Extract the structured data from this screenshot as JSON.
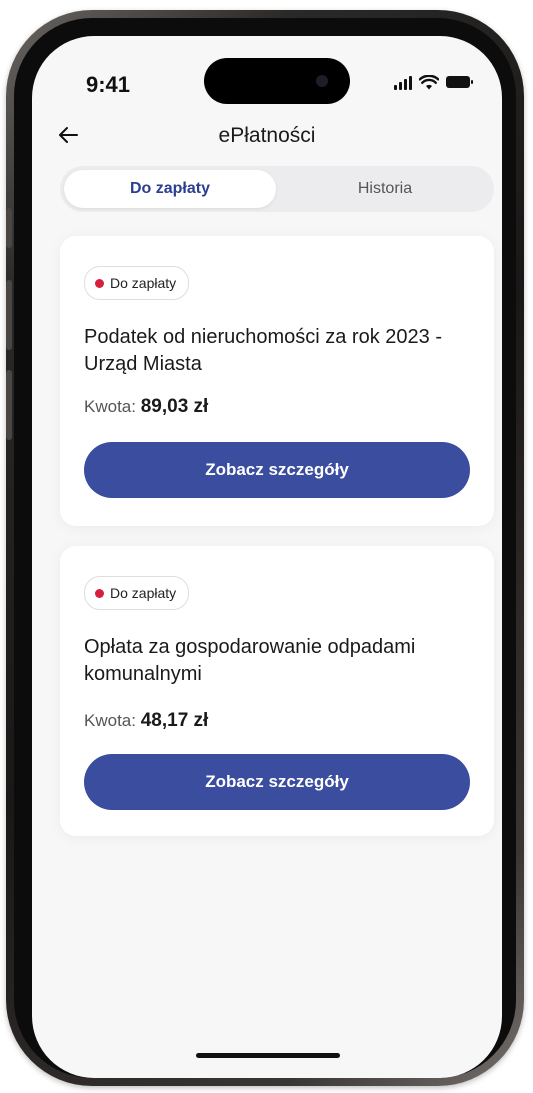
{
  "status_bar": {
    "time": "9:41"
  },
  "header": {
    "title": "ePłatności"
  },
  "tabs": [
    {
      "label": "Do zapłaty",
      "active": true
    },
    {
      "label": "Historia",
      "active": false
    }
  ],
  "payments": [
    {
      "status": "Do zapłaty",
      "title": "Podatek od nieruchomości za rok 2023 - Urząd Miasta",
      "amount_label": "Kwota:",
      "amount_value": "89,03 zł",
      "button_label": "Zobacz szczegóły"
    },
    {
      "status": "Do zapłaty",
      "title": "Opłata za gospodarowanie odpadami komunalnymi",
      "amount_label": "Kwota:",
      "amount_value": "48,17 zł",
      "button_label": "Zobacz szczegóły"
    }
  ],
  "colors": {
    "accent": "#3a4d9e",
    "status_unpaid": "#d61f3c",
    "background": "#f7f7f8",
    "card": "#ffffff"
  },
  "icons": {
    "back": "arrow-left-icon",
    "signal": "cellular-signal-icon",
    "wifi": "wifi-icon",
    "battery": "battery-icon"
  }
}
